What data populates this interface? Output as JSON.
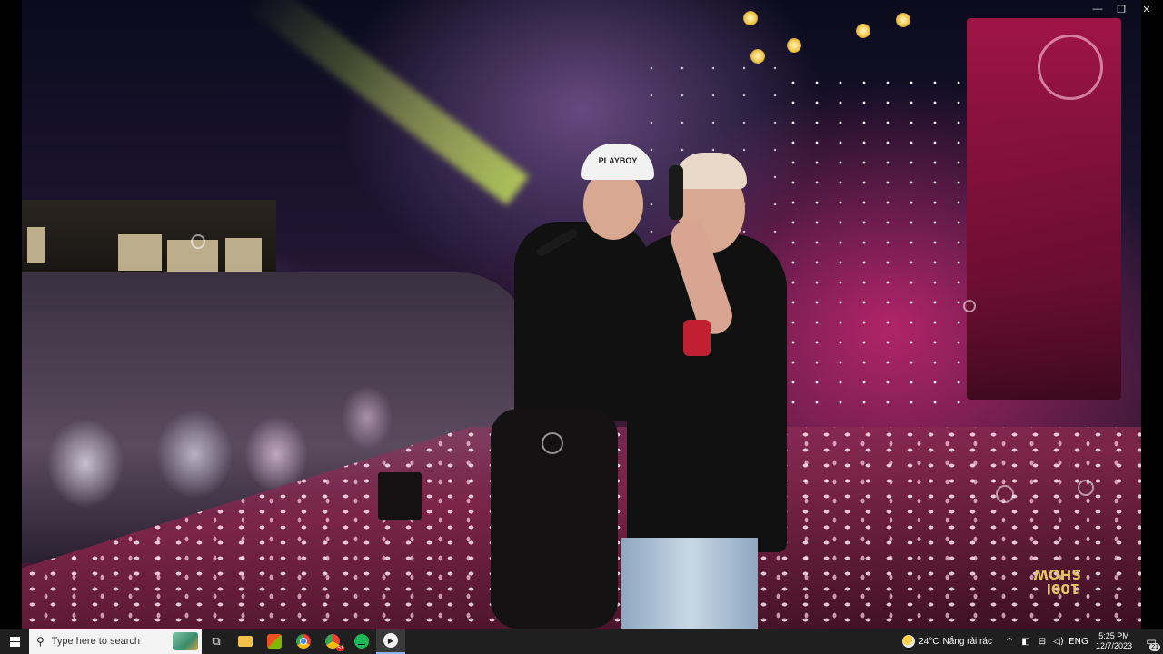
{
  "window": {
    "minimize_glyph": "—",
    "restore_glyph": "❐",
    "close_glyph": "✕"
  },
  "video": {
    "logo_text": "100l\nSHOW",
    "cap_text": "PLAYBOY"
  },
  "taskbar": {
    "search": {
      "placeholder": "Type here to search"
    },
    "apps": [
      {
        "name": "task-view",
        "glyph": "⧉"
      },
      {
        "name": "file-explorer",
        "glyph": ""
      },
      {
        "name": "microsoft-store",
        "glyph": ""
      },
      {
        "name": "chrome",
        "glyph": ""
      },
      {
        "name": "chrome-badge",
        "glyph": "51"
      },
      {
        "name": "spotify",
        "glyph": ""
      },
      {
        "name": "media-player",
        "glyph": "▶"
      }
    ],
    "weather": {
      "temp": "24°C",
      "condition": "Nắng rải rác"
    },
    "tray": {
      "chevron": "^",
      "language": "ENG"
    },
    "clock": {
      "time": "5:25 PM",
      "date": "12/7/2023"
    },
    "notifications": {
      "count": "21"
    },
    "colors": {
      "bar": "#1f1f1f",
      "search_bg": "#f3f3f3",
      "active_indicator": "#8ab4f8"
    }
  }
}
